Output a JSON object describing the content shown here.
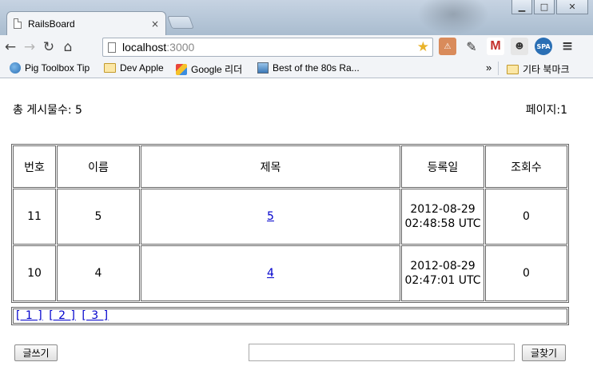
{
  "browser": {
    "tab_title": "RailsBoard",
    "tab_close": "×",
    "window_buttons": {
      "minimize": "▁",
      "maximize": "□",
      "close": "✕"
    },
    "url_host": "localhost",
    "url_port": ":3000",
    "nav": {
      "back": "←",
      "forward": "→",
      "reload": "↻",
      "home": "⌂"
    },
    "star": "★",
    "extensions": {
      "security": "⚠",
      "tool": "✎",
      "gmail": "M",
      "robot": "☻",
      "spa": "SPA",
      "menu": "≡"
    },
    "bookmarks": [
      "Pig Toolbox Tip",
      "Dev Apple",
      "Google 리더",
      "Best of the 80s Ra..."
    ],
    "bookmarks_overflow": "»",
    "other_bookmarks": "기타 북마크"
  },
  "board": {
    "total_label": "총 게시물수: 5",
    "page_label": "페이지:1",
    "columns": [
      "번호",
      "이름",
      "제목",
      "등록일",
      "조회수"
    ],
    "rows": [
      {
        "no": "11",
        "name": "5",
        "title": "5",
        "date_line1": "2012-08-29",
        "date_line2": "02:48:58 UTC",
        "views": "0"
      },
      {
        "no": "10",
        "name": "4",
        "title": "4",
        "date_line1": "2012-08-29",
        "date_line2": "02:47:01 UTC",
        "views": "0"
      }
    ],
    "pages": [
      "[ 1 ]",
      "[ 2 ]",
      "[ 3 ]"
    ],
    "write_button": "글쓰기",
    "search_value": "",
    "search_button": "글찾기"
  }
}
